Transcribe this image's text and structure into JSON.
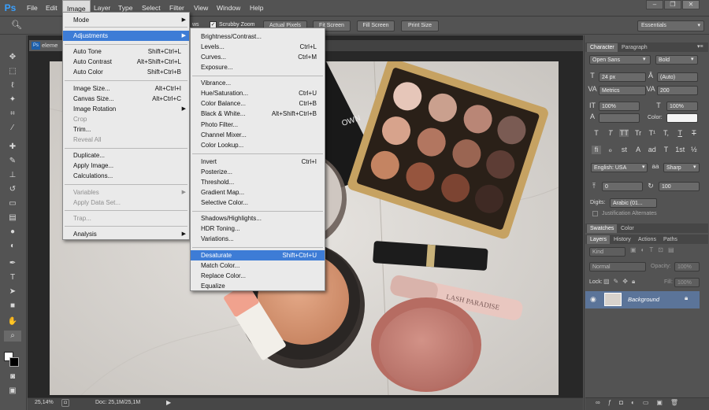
{
  "app": {
    "logo": "Ps"
  },
  "menubar": {
    "items": [
      "File",
      "Edit",
      "Image",
      "Layer",
      "Type",
      "Select",
      "Filter",
      "View",
      "Window",
      "Help"
    ]
  },
  "window_controls": {
    "minimize": "–",
    "restore": "❐",
    "close": "✕"
  },
  "options_bar": {
    "windows_label": "ws",
    "scrubby_zoom": "Scrubby Zoom",
    "actual_pixels": "Actual Pixels",
    "fit_screen": "Fit Screen",
    "fill_screen": "Fill Screen",
    "print_size": "Print Size",
    "workspace": "Essentials"
  },
  "document": {
    "tab_label": "eleme",
    "zoom": "25,14%",
    "doc_info": "Doc: 25,1M/25,1M"
  },
  "image_menu": {
    "items": [
      {
        "label": "Mode",
        "shortcut": "",
        "submenu": true,
        "disabled": false
      },
      {
        "label": "Adjustments",
        "shortcut": "",
        "submenu": true,
        "disabled": false,
        "highlighted": true
      },
      {
        "label": "Auto Tone",
        "shortcut": "Shift+Ctrl+L"
      },
      {
        "label": "Auto Contrast",
        "shortcut": "Alt+Shift+Ctrl+L"
      },
      {
        "label": "Auto Color",
        "shortcut": "Shift+Ctrl+B"
      },
      {
        "label": "Image Size...",
        "shortcut": "Alt+Ctrl+I"
      },
      {
        "label": "Canvas Size...",
        "shortcut": "Alt+Ctrl+C"
      },
      {
        "label": "Image Rotation",
        "shortcut": "",
        "submenu": true
      },
      {
        "label": "Crop",
        "shortcut": "",
        "disabled": true
      },
      {
        "label": "Trim...",
        "shortcut": ""
      },
      {
        "label": "Reveal All",
        "shortcut": "",
        "disabled": true
      },
      {
        "label": "Duplicate...",
        "shortcut": ""
      },
      {
        "label": "Apply Image...",
        "shortcut": ""
      },
      {
        "label": "Calculations...",
        "shortcut": ""
      },
      {
        "label": "Variables",
        "shortcut": "",
        "submenu": true,
        "disabled": true
      },
      {
        "label": "Apply Data Set...",
        "shortcut": "",
        "disabled": true
      },
      {
        "label": "Trap...",
        "shortcut": "",
        "disabled": true
      },
      {
        "label": "Analysis",
        "shortcut": "",
        "submenu": true
      }
    ]
  },
  "adjustments_menu": {
    "items": [
      {
        "label": "Brightness/Contrast...",
        "shortcut": ""
      },
      {
        "label": "Levels...",
        "shortcut": "Ctrl+L"
      },
      {
        "label": "Curves...",
        "shortcut": "Ctrl+M"
      },
      {
        "label": "Exposure...",
        "shortcut": ""
      },
      {
        "label": "Vibrance...",
        "shortcut": ""
      },
      {
        "label": "Hue/Saturation...",
        "shortcut": "Ctrl+U"
      },
      {
        "label": "Color Balance...",
        "shortcut": "Ctrl+B"
      },
      {
        "label": "Black & White...",
        "shortcut": "Alt+Shift+Ctrl+B"
      },
      {
        "label": "Photo Filter...",
        "shortcut": ""
      },
      {
        "label": "Channel Mixer...",
        "shortcut": ""
      },
      {
        "label": "Color Lookup...",
        "shortcut": ""
      },
      {
        "label": "Invert",
        "shortcut": "Ctrl+I"
      },
      {
        "label": "Posterize...",
        "shortcut": ""
      },
      {
        "label": "Threshold...",
        "shortcut": ""
      },
      {
        "label": "Gradient Map...",
        "shortcut": ""
      },
      {
        "label": "Selective Color...",
        "shortcut": ""
      },
      {
        "label": "Shadows/Highlights...",
        "shortcut": ""
      },
      {
        "label": "HDR Toning...",
        "shortcut": ""
      },
      {
        "label": "Variations...",
        "shortcut": ""
      },
      {
        "label": "Desaturate",
        "shortcut": "Shift+Ctrl+U",
        "highlighted": true
      },
      {
        "label": "Match Color...",
        "shortcut": ""
      },
      {
        "label": "Replace Color...",
        "shortcut": ""
      },
      {
        "label": "Equalize",
        "shortcut": ""
      }
    ]
  },
  "character_panel": {
    "tabs": [
      "Character",
      "Paragraph"
    ],
    "font_family": "Open Sans",
    "font_style": "Bold",
    "font_size": "24 px",
    "leading": "(Auto)",
    "kerning": "Metrics",
    "tracking": "200",
    "vertical_scale": "100%",
    "horizontal_scale": "100%",
    "color_label": "Color:",
    "language": "English: USA",
    "antialias": "Sharp",
    "baseline_shift": "0",
    "rotation_value": "100",
    "digits_label": "Digits:",
    "digits_value": "Arabic (01...",
    "justification_alternates": "Justification Alternates",
    "type_buttons": [
      "T",
      "T",
      "TT",
      "Tr",
      "T¹",
      "T,",
      "T",
      "T"
    ],
    "opentype_buttons": [
      "fi",
      "ℴ",
      "st",
      "A",
      "ad",
      "T",
      "1st",
      "½"
    ]
  },
  "swatches_panel": {
    "tabs": [
      "Swatches",
      "Color"
    ]
  },
  "layers_panel": {
    "tabs": [
      "Layers",
      "History",
      "Actions",
      "Paths"
    ],
    "kind": "Kind",
    "blend_mode": "Normal",
    "opacity_label": "Opacity:",
    "opacity": "100%",
    "lock_label": "Lock:",
    "fill_label": "Fill:",
    "fill": "100%",
    "layers": [
      {
        "name": "Background",
        "visible": true,
        "locked": true
      }
    ]
  },
  "colors": {
    "accent": "#3d7cd6",
    "ui_bg": "#535353",
    "menu_bg": "#eaeaea"
  }
}
